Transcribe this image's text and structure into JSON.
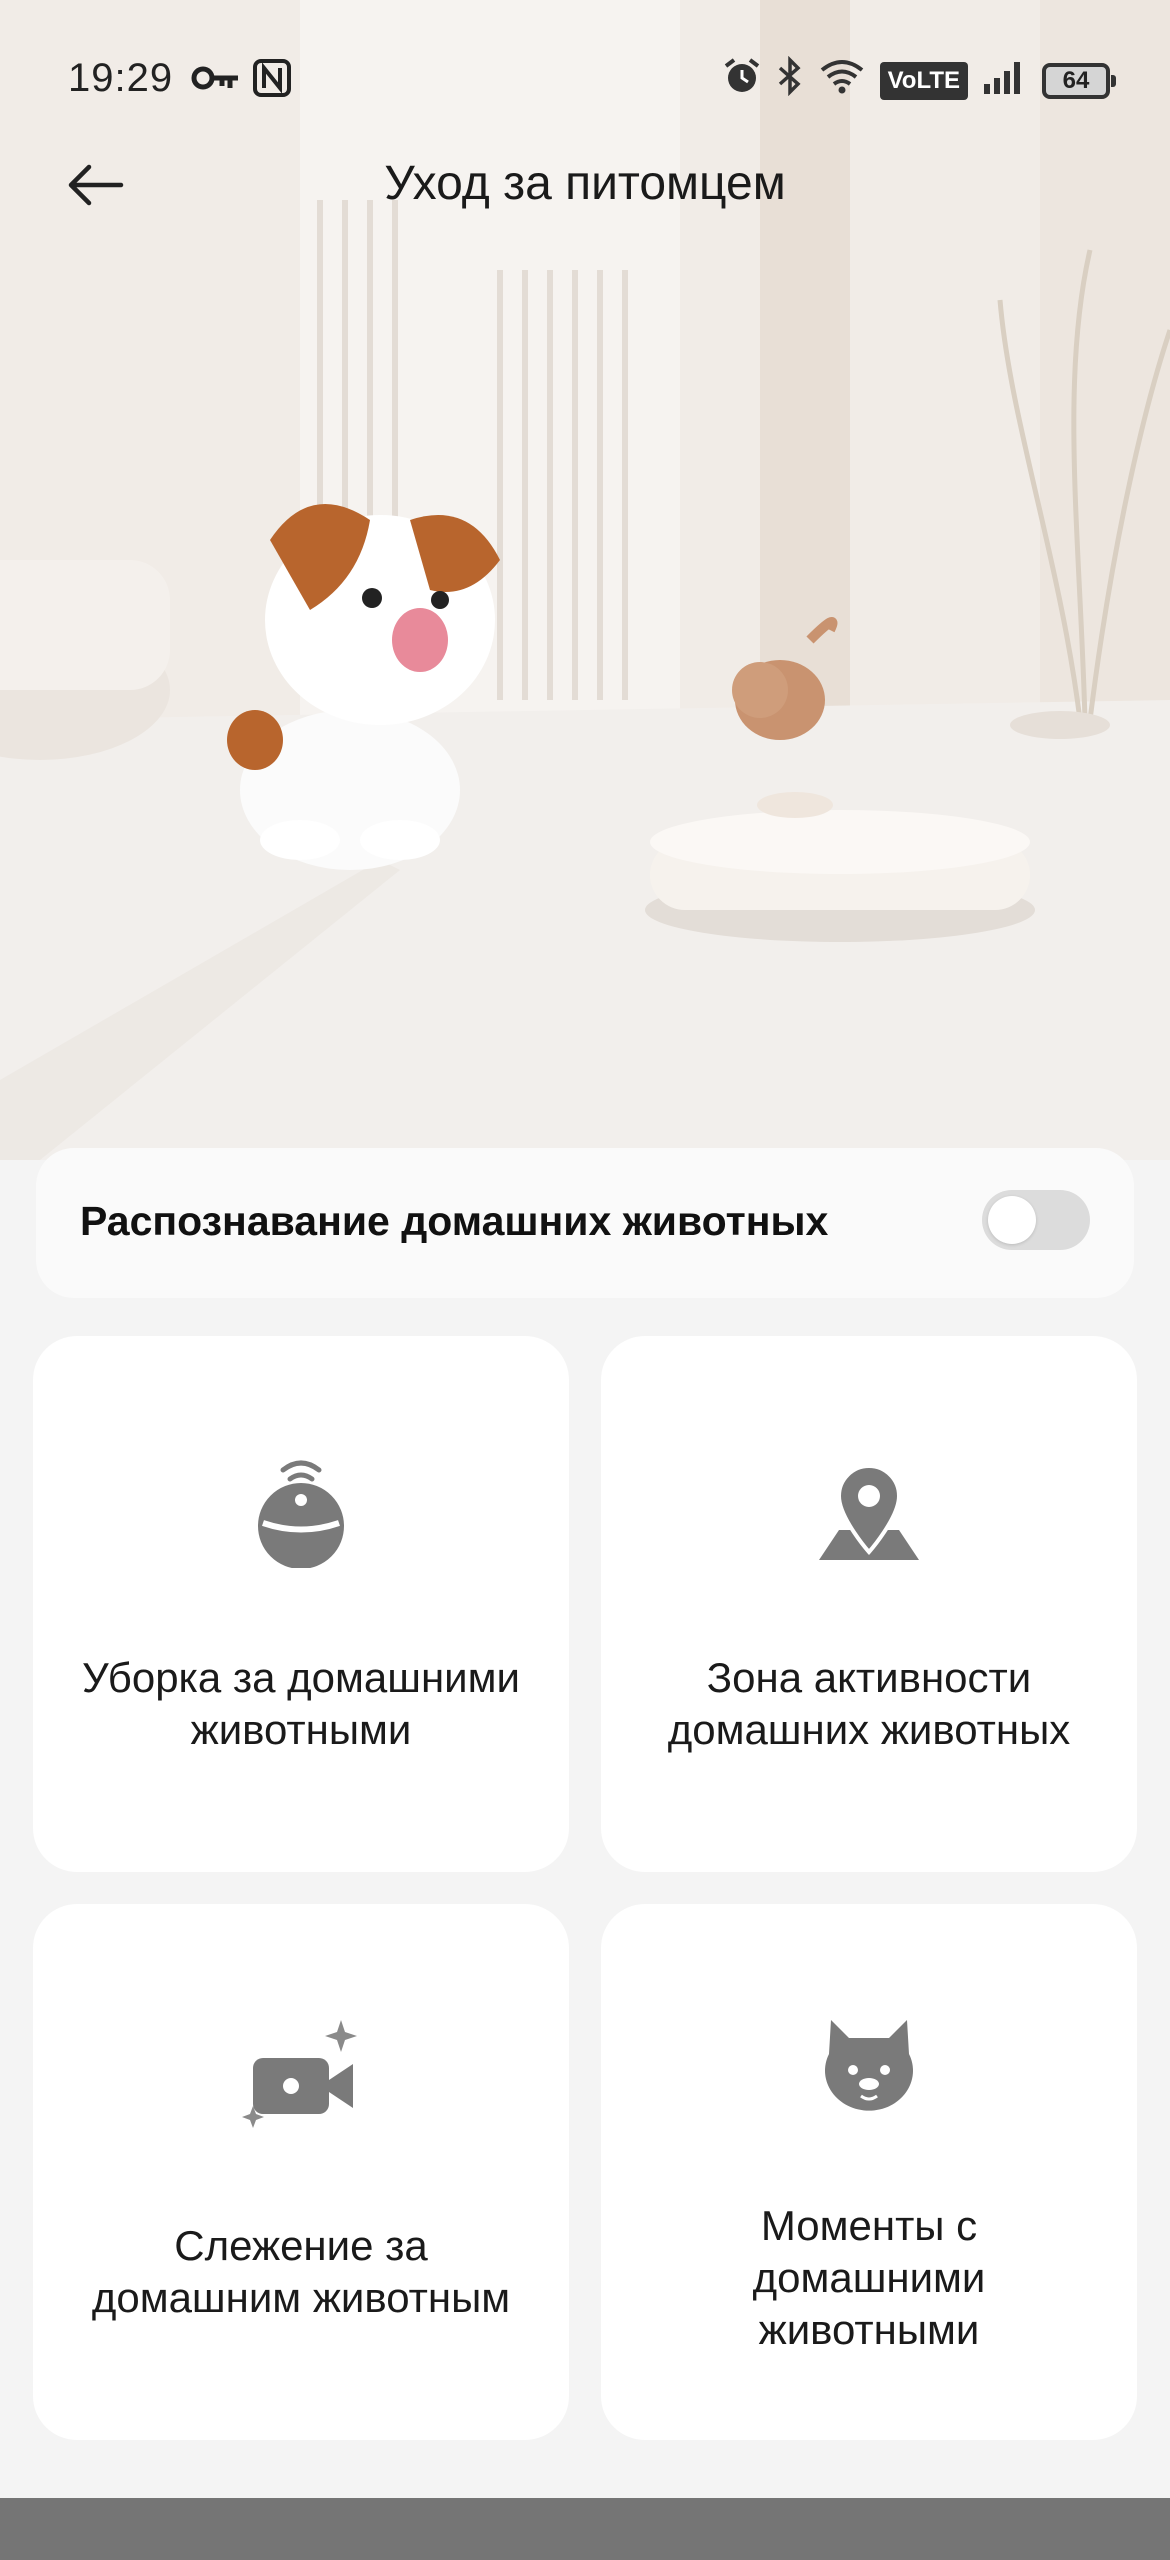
{
  "status_bar": {
    "time": "19:29",
    "volte": "VoLTE",
    "battery_level": "64",
    "icons": [
      "key-icon",
      "nfc-icon",
      "alarm-icon",
      "bluetooth-icon",
      "wifi-icon",
      "volte-badge",
      "signal-icon",
      "battery-icon"
    ]
  },
  "app_bar": {
    "title": "Уход за питомцем",
    "back_icon": "arrow-left-icon"
  },
  "pet_recognition": {
    "label": "Распознавание домашних животных",
    "enabled": false
  },
  "features": [
    {
      "label_line1": "Уборка за домашними",
      "label_line2": "животными",
      "label_line3": "",
      "icon": "robot-vacuum-icon"
    },
    {
      "label_line1": "Зона активности",
      "label_line2": "домашних животных",
      "label_line3": "",
      "icon": "map-pin-icon"
    },
    {
      "label_line1": "Слежение за",
      "label_line2": "домашним животным",
      "label_line3": "",
      "icon": "video-camera-icon"
    },
    {
      "label_line1": "Моменты с",
      "label_line2": "домашними",
      "label_line3": "животными",
      "icon": "pet-face-icon"
    }
  ],
  "colors": {
    "background": "#f4f4f4",
    "card": "#ffffff",
    "icon_gray": "#7a7a7a",
    "toggle_off": "#dcdcdc"
  }
}
